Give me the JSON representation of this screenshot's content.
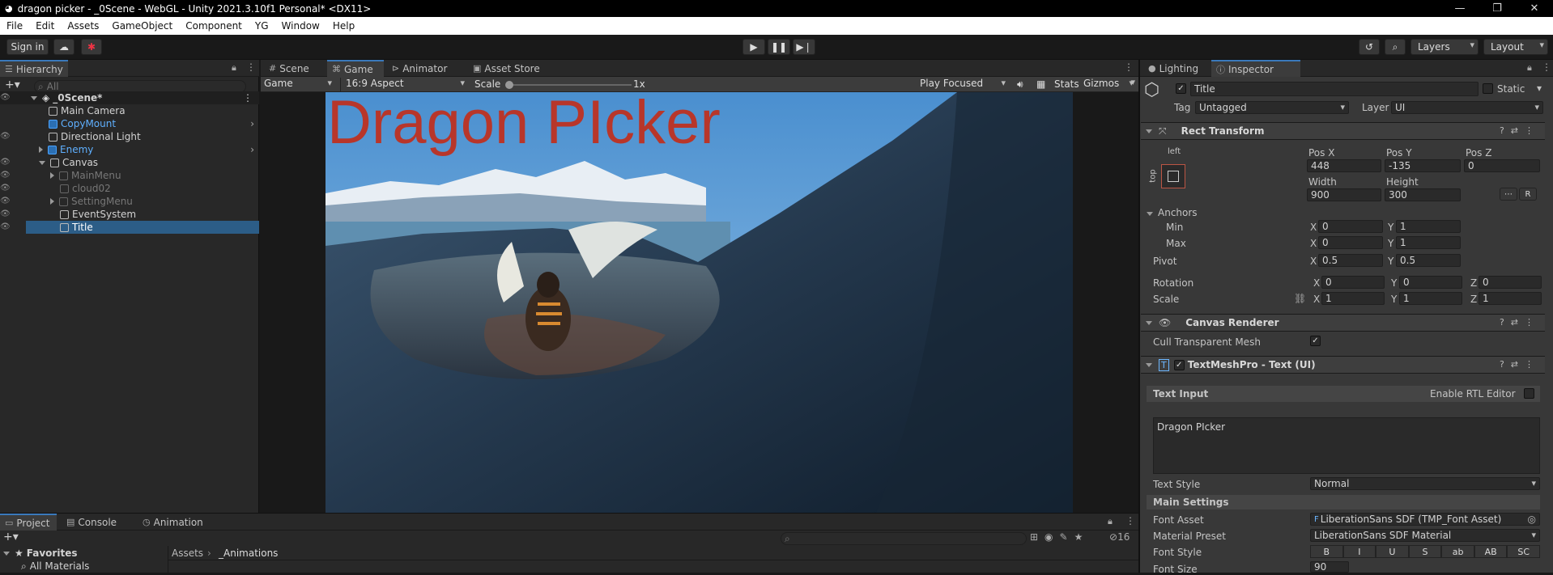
{
  "window": {
    "title": "dragon picker - _0Scene - WebGL - Unity 2021.3.10f1 Personal* <DX11>",
    "controls": [
      "—",
      "❐",
      "✕"
    ]
  },
  "menu": [
    "File",
    "Edit",
    "Assets",
    "GameObject",
    "Component",
    "YG",
    "Window",
    "Help"
  ],
  "toolbar": {
    "sign_in": "Sign in",
    "layers": "Layers",
    "layout": "Layout"
  },
  "hierarchy": {
    "tab": "Hierarchy",
    "search_placeholder": "All",
    "items": [
      {
        "label": "_0Scene*"
      },
      {
        "label": "Main Camera"
      },
      {
        "label": "CopyMount"
      },
      {
        "label": "Directional Light"
      },
      {
        "label": "Enemy"
      },
      {
        "label": "Canvas"
      },
      {
        "label": "MainMenu"
      },
      {
        "label": "cloud02"
      },
      {
        "label": "SettingMenu"
      },
      {
        "label": "EventSystem"
      },
      {
        "label": "Title"
      }
    ]
  },
  "center": {
    "tabs": [
      "Scene",
      "Game",
      "Animator",
      "Asset Store"
    ],
    "game_display": "Game",
    "aspect": "16:9 Aspect",
    "scale_label": "Scale",
    "scale_value": "1x",
    "play_focused": "Play Focused",
    "stats": "Stats",
    "gizmos": "Gizmos",
    "game_title": "Dragon PIcker"
  },
  "bottom": {
    "tabs": [
      "Project",
      "Console",
      "Animation"
    ],
    "favorites": "Favorites",
    "all_materials": "All Materials",
    "breadcrumb": [
      "Assets",
      "_Animations"
    ],
    "hidden_count": "16"
  },
  "right_tabs": [
    "Lighting",
    "Inspector"
  ],
  "inspector": {
    "object_name": "Title",
    "static_label": "Static",
    "tag_label": "Tag",
    "tag_value": "Untagged",
    "layer_label": "Layer",
    "layer_value": "UI",
    "rect_transform": {
      "title": "Rect Transform",
      "anchor_h": "left",
      "anchor_v": "top",
      "pos_x_label": "Pos X",
      "pos_x": "448",
      "pos_y_label": "Pos Y",
      "pos_y": "-135",
      "pos_z_label": "Pos Z",
      "pos_z": "0",
      "width_label": "Width",
      "width": "900",
      "height_label": "Height",
      "height": "300",
      "anchors_label": "Anchors",
      "min_label": "Min",
      "min_x": "0",
      "min_y": "1",
      "max_label": "Max",
      "max_x": "0",
      "max_y": "1",
      "pivot_label": "Pivot",
      "pivot_x": "0.5",
      "pivot_y": "0.5",
      "rotation_label": "Rotation",
      "rot_x": "0",
      "rot_y": "0",
      "rot_z": "0",
      "scale_label": "Scale",
      "scale_x": "1",
      "scale_y": "1",
      "scale_z": "1",
      "r_button": "R"
    },
    "canvas_renderer": {
      "title": "Canvas Renderer",
      "cull_label": "Cull Transparent Mesh"
    },
    "tmp": {
      "title": "TextMeshPro - Text (UI)",
      "text_input_label": "Text Input",
      "rtl_label": "Enable RTL Editor",
      "text_value": "Dragon PIcker",
      "text_style_label": "Text Style",
      "text_style_value": "Normal",
      "main_settings": "Main Settings",
      "font_asset_label": "Font Asset",
      "font_asset_value": "LiberationSans SDF (TMP_Font Asset)",
      "material_label": "Material Preset",
      "material_value": "LiberationSans SDF Material",
      "font_style_label": "Font Style",
      "font_styles": [
        "B",
        "I",
        "U",
        "S",
        "ab",
        "AB",
        "SC"
      ],
      "font_size_label": "Font Size",
      "font_size_value": "90"
    }
  },
  "colors": {
    "title_red": "#b8362a",
    "selection": "#2c5d87",
    "prefab_blue": "#4aa3ff"
  }
}
